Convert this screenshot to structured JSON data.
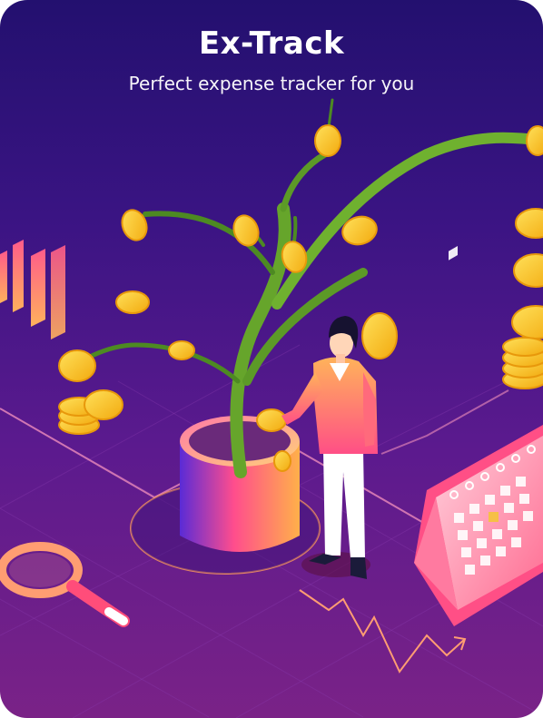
{
  "app": {
    "title": "Ex-Track",
    "subtitle": "Perfect expense tracker for you"
  },
  "illustration": {
    "name": "money-tree-hero-illustration",
    "elements": [
      "money-tree-icon",
      "coin-icon",
      "person-figure",
      "calendar-icon",
      "magnifier-icon",
      "bar-chart-icon",
      "trend-arrow-icon"
    ]
  },
  "colors": {
    "background_top": "#23106f",
    "background_bottom": "#7a2287",
    "coin": "#f8c51e",
    "accent_pink": "#ff4d8d",
    "accent_orange": "#ffb04a",
    "leaf_green": "#69a52c"
  }
}
